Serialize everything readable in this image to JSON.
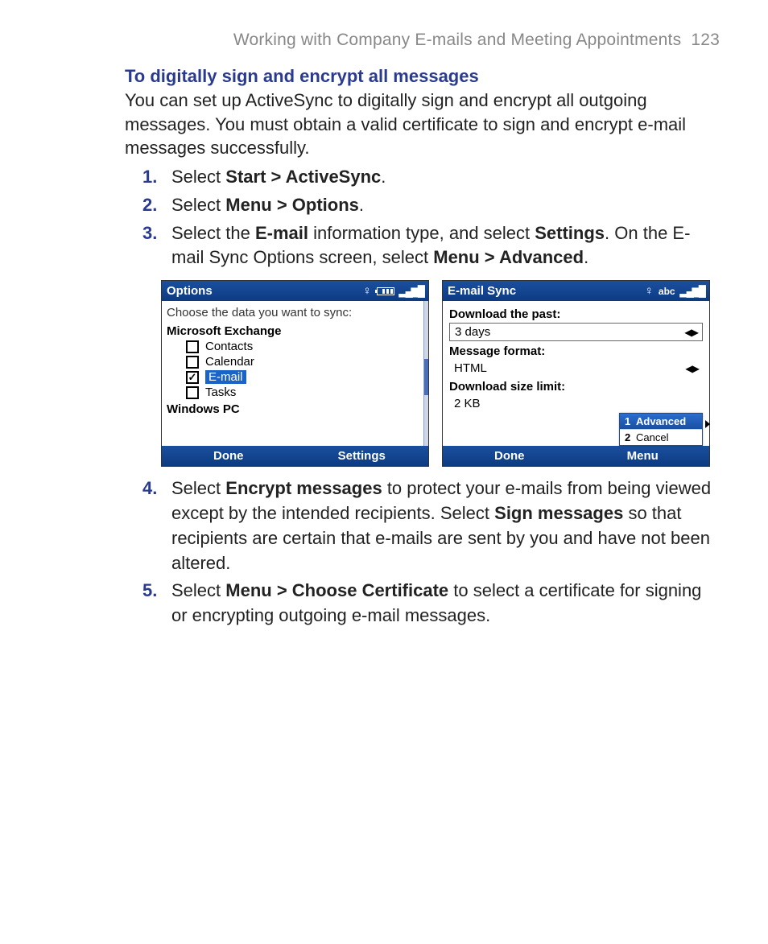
{
  "page": {
    "header": "Working with Company E-mails and Meeting Appointments",
    "number": "123"
  },
  "heading": "To digitally sign and encrypt all messages",
  "intro": "You can set up ActiveSync to digitally sign and encrypt all outgoing messages. You must obtain a valid certificate to sign and encrypt e-mail messages successfully.",
  "steps": {
    "s1": {
      "num": "1.",
      "pre": "Select ",
      "bold": "Start > ActiveSync",
      "post": "."
    },
    "s2": {
      "num": "2.",
      "pre": "Select ",
      "bold": "Menu > Options",
      "post": "."
    },
    "s3": {
      "num": "3.",
      "t1": "Select the ",
      "b1": "E-mail",
      "t2": " information type, and select ",
      "b2": "Settings",
      "t3": ". On the E-mail Sync Options screen, select ",
      "b3": "Menu > Advanced",
      "t4": "."
    },
    "s4": {
      "num": "4.",
      "t1": "Select ",
      "b1": "Encrypt messages",
      "t2": " to protect your e-mails from being viewed except by the intended recipients. Select ",
      "b2": "Sign messages",
      "t3": " so that recipients are certain that e-mails are sent by you and have not been altered."
    },
    "s5": {
      "num": "5.",
      "t1": "Select ",
      "b1": "Menu > Choose Certificate",
      "t2": " to select a certificate for signing or encrypting outgoing e-mail messages."
    }
  },
  "phone1": {
    "title": "Options",
    "instr": "Choose the data you want to sync:",
    "group1": "Microsoft Exchange",
    "items": {
      "contacts": "Contacts",
      "calendar": "Calendar",
      "email": "E-mail",
      "tasks": "Tasks"
    },
    "group2": "Windows PC",
    "soft_left": "Done",
    "soft_right": "Settings"
  },
  "phone2": {
    "title": "E-mail Sync",
    "abc": "abc",
    "labels": {
      "past": "Download the past:",
      "format": "Message format:",
      "limit": "Download size limit:"
    },
    "values": {
      "past": "3 days",
      "format": "HTML",
      "limit": "2 KB"
    },
    "menu": {
      "i1k": "1",
      "i1": "Advanced",
      "i2k": "2",
      "i2": "Cancel"
    },
    "soft_left": "Done",
    "soft_right": "Menu"
  }
}
